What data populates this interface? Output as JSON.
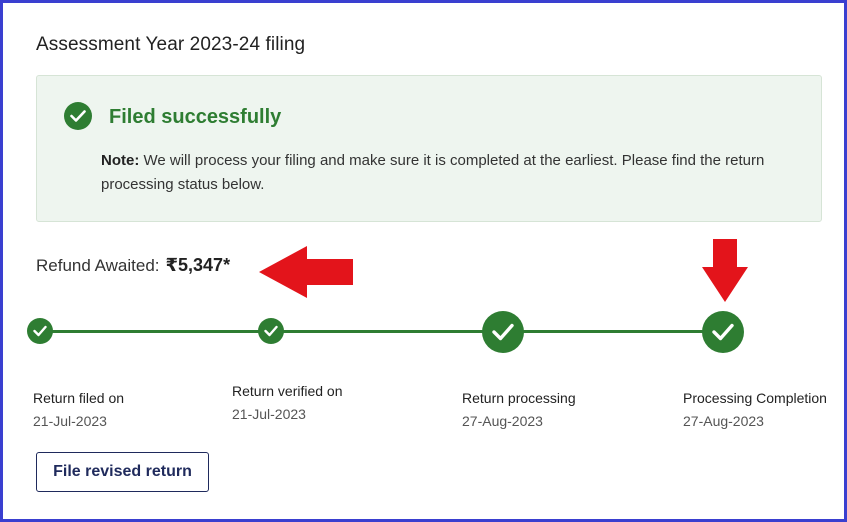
{
  "header": {
    "title": "Assessment Year 2023-24 filing"
  },
  "status": {
    "title": "Filed successfully",
    "note_label": "Note:",
    "note_text": " We will process your filing and make sure it is completed at the earliest. Please find the return processing status below."
  },
  "refund": {
    "label": "Refund Awaited:",
    "amount": "₹5,347*"
  },
  "timeline": {
    "steps": [
      {
        "label": "Return filed on",
        "date": "21-Jul-2023"
      },
      {
        "label": "Return verified on",
        "date": "21-Jul-2023"
      },
      {
        "label": "Return processing",
        "date": "27-Aug-2023"
      },
      {
        "label": "Processing Completion",
        "date": "27-Aug-2023"
      }
    ]
  },
  "actions": {
    "revise_label": "File revised return"
  },
  "colors": {
    "success": "#2e7d32",
    "annotation_arrow": "#e3141b",
    "frame_border": "#3a3fd0"
  },
  "icons": {
    "status": "check-circle-icon",
    "step": "check-circle-icon",
    "annotations": [
      "arrow-left-icon",
      "arrow-down-icon"
    ]
  }
}
